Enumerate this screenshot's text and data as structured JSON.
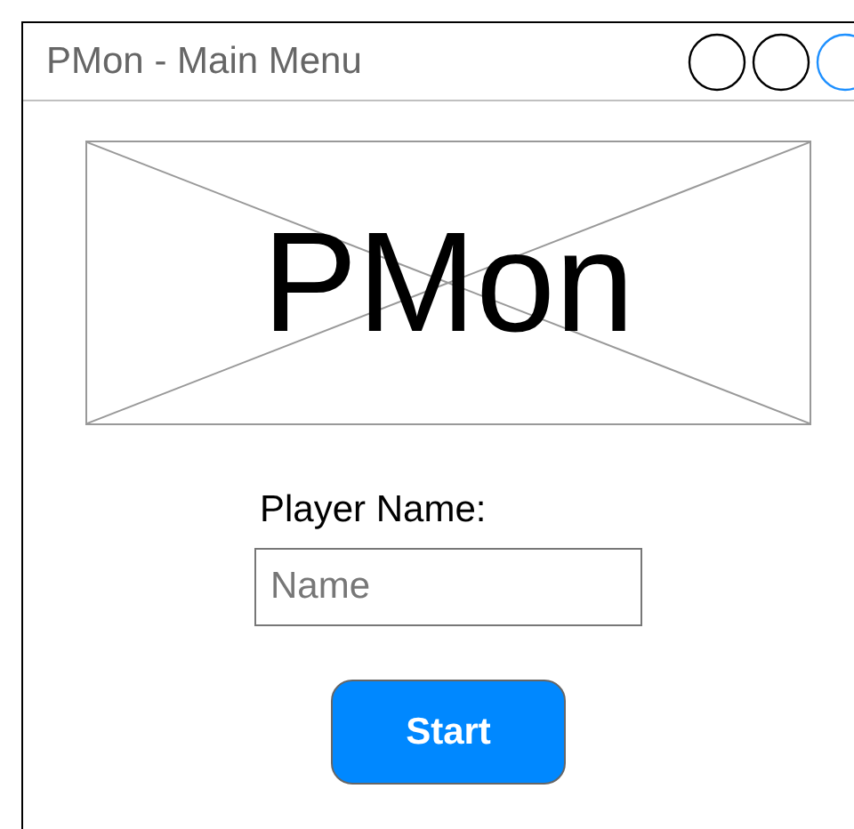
{
  "window": {
    "title": "PMon - Main Menu"
  },
  "logo": {
    "text": "PMon"
  },
  "player_name": {
    "label": "Player Name:",
    "placeholder": "Name"
  },
  "buttons": [
    "Start"
  ]
}
